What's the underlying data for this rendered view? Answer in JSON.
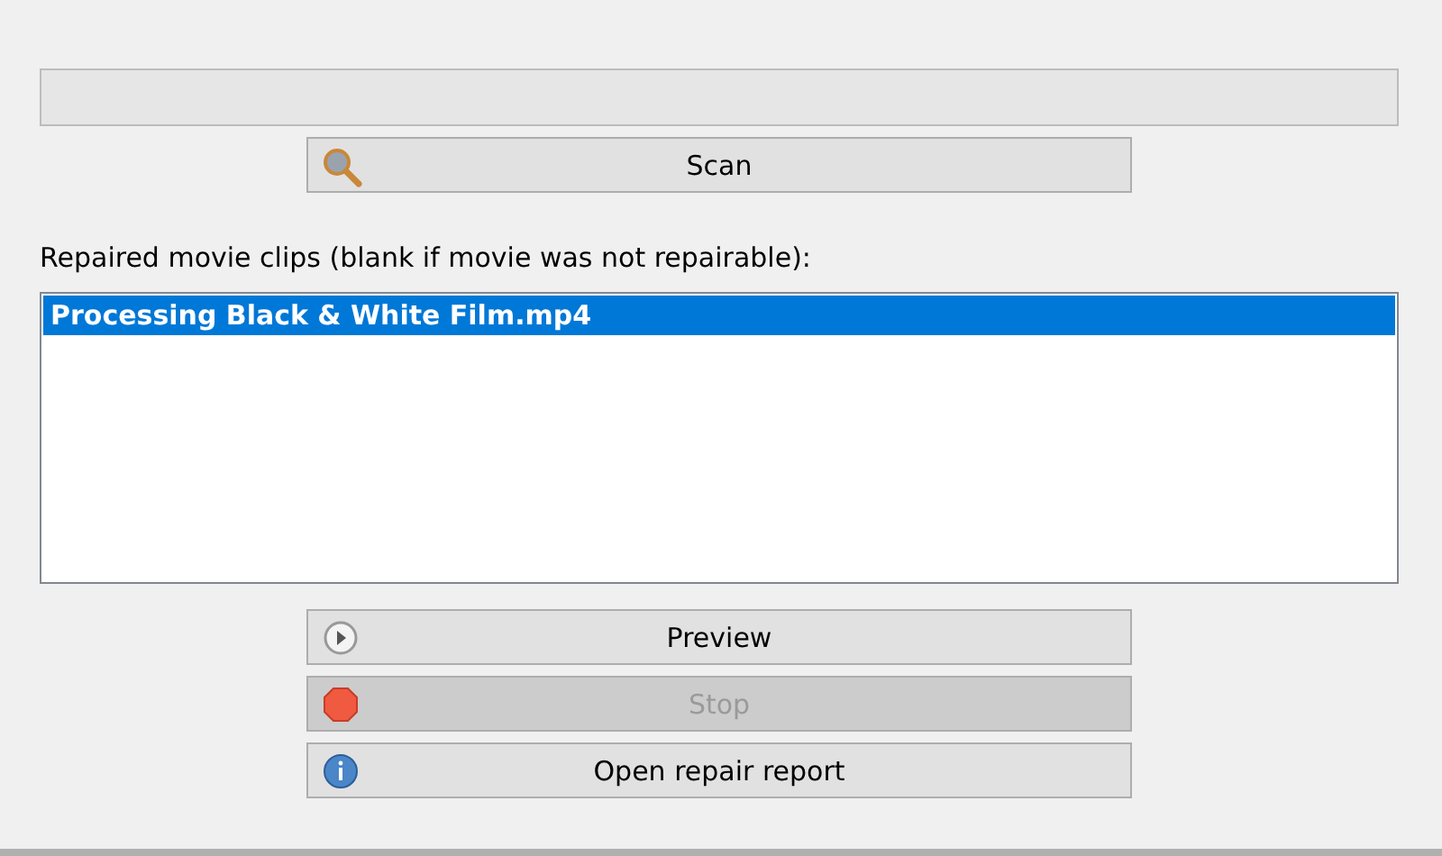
{
  "scan_button": {
    "label": "Scan",
    "kind": "search",
    "disabled": false
  },
  "list_label": "Repaired movie clips (blank if movie was not repairable):",
  "clips": [
    {
      "name": "Processing Black & White Film.mp4",
      "selected": true
    }
  ],
  "buttons": [
    {
      "label": "Preview",
      "kind": "play",
      "disabled": false
    },
    {
      "label": "Stop",
      "kind": "stop",
      "disabled": true
    },
    {
      "label": "Open repair report",
      "kind": "info",
      "disabled": false
    }
  ]
}
